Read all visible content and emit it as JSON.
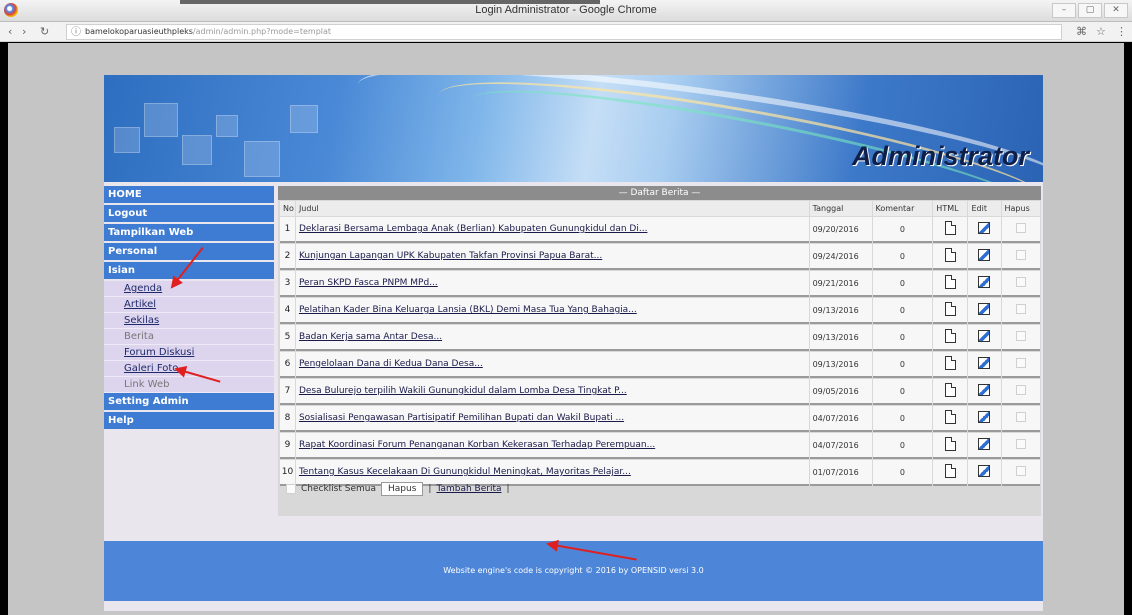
{
  "browser": {
    "window_title": "Login Administrator - Google Chrome",
    "url_host": "bamelokoparuasieuthpleks",
    "url_path": "/admin/admin.php?mode=templat",
    "window_buttons": [
      "–",
      "▢",
      "✕"
    ]
  },
  "banner": {
    "logo_text": "Administrator"
  },
  "sidebar": {
    "menu": [
      {
        "label": "HOME",
        "type": "head"
      },
      {
        "label": "Logout",
        "type": "head"
      },
      {
        "label": "Tampilkan Web",
        "type": "head"
      },
      {
        "label": "Personal",
        "type": "head"
      },
      {
        "label": "Isian",
        "type": "head"
      },
      {
        "label": "Agenda",
        "type": "sub"
      },
      {
        "label": "Artikel",
        "type": "sub"
      },
      {
        "label": "Sekilas",
        "type": "sub"
      },
      {
        "label": "Berita",
        "type": "sub-plain"
      },
      {
        "label": "Forum Diskusi",
        "type": "sub"
      },
      {
        "label": "Galeri Foto",
        "type": "sub"
      },
      {
        "label": "Link Web",
        "type": "sub-plain"
      },
      {
        "label": "Setting Admin",
        "type": "head"
      },
      {
        "label": "Help",
        "type": "head"
      }
    ]
  },
  "content": {
    "list_title": "— Daftar Berita —",
    "columns": [
      "No",
      "Judul",
      "Tanggal",
      "Komentar",
      "HTML",
      "Edit",
      "Hapus"
    ],
    "rows": [
      {
        "no": "1",
        "judul": "Deklarasi Bersama Lembaga Anak (Berlian) Kabupaten Gunungkidul dan Di...",
        "tanggal": "09/20/2016",
        "komentar": "0"
      },
      {
        "no": "2",
        "judul": "Kunjungan Lapangan UPK Kabupaten Takfan Provinsi Papua Barat...",
        "tanggal": "09/24/2016",
        "komentar": "0"
      },
      {
        "no": "3",
        "judul": "Peran SKPD Fasca PNPM MPd...",
        "tanggal": "09/21/2016",
        "komentar": "0"
      },
      {
        "no": "4",
        "judul": "Pelatihan Kader Bina Keluarga Lansia (BKL) Demi Masa Tua Yang Bahagia...",
        "tanggal": "09/13/2016",
        "komentar": "0"
      },
      {
        "no": "5",
        "judul": "Badan Kerja sama Antar Desa...",
        "tanggal": "09/13/2016",
        "komentar": "0"
      },
      {
        "no": "6",
        "judul": "Pengelolaan Dana di Kedua Dana Desa...",
        "tanggal": "09/13/2016",
        "komentar": "0"
      },
      {
        "no": "7",
        "judul": "Desa Bulurejo terpilih Wakili Gunungkidul dalam Lomba Desa Tingkat P...",
        "tanggal": "09/05/2016",
        "komentar": "0"
      },
      {
        "no": "8",
        "judul": "Sosialisasi Pengawasan Partisipatif Pemilihan Bupati dan Wakil Bupati ...",
        "tanggal": "04/07/2016",
        "komentar": "0"
      },
      {
        "no": "9",
        "judul": "Rapat Koordinasi Forum Penanganan Korban Kekerasan Terhadap Perempuan...",
        "tanggal": "04/07/2016",
        "komentar": "0"
      },
      {
        "no": "10",
        "judul": "Tentang Kasus Kecelakaan Di Gunungkidul Meningkat, Mayoritas Pelajar...",
        "tanggal": "01/07/2016",
        "komentar": "0"
      }
    ],
    "checkall_label": "Checklist Semua",
    "delete_button": "Hapus",
    "add_link": "Tambah Berita"
  },
  "footer": {
    "text": "Website engine's code is copyright © 2016 by OPENSID versi 3.0"
  },
  "colors": {
    "menu_head": "#3e7bd2",
    "submenu_bg": "#ddd4ee",
    "footer": "#4d86d8",
    "annotation": "#e02020"
  }
}
